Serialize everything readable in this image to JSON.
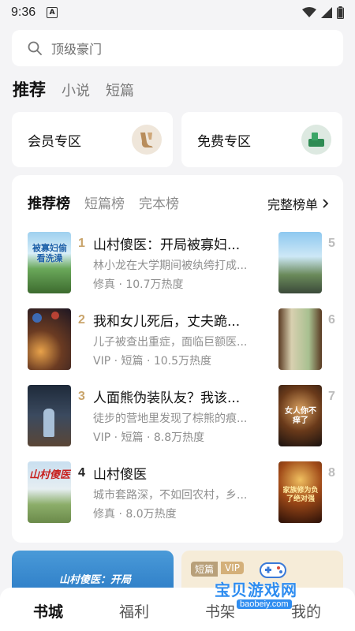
{
  "status": {
    "time": "9:36",
    "notif": "A"
  },
  "search": {
    "placeholder_text": "顶级豪门"
  },
  "top_tabs": [
    "推荐",
    "小说",
    "短篇"
  ],
  "zones": {
    "member": "会员专区",
    "free": "免费专区"
  },
  "rank": {
    "tabs": [
      "推荐榜",
      "短篇榜",
      "完本榜"
    ],
    "full_list": "完整榜单",
    "books": [
      {
        "rank": "1",
        "title": "山村傻医：开局被寡妇...",
        "desc": "林小龙在大学期间被纨绔打成...",
        "meta": "修真 · 10.7万热度",
        "cover_text": "被寡妇偷看洗澡"
      },
      {
        "rank": "2",
        "title": "我和女儿死后，丈夫跪...",
        "desc": "儿子被查出重症，面临巨额医...",
        "meta": "VIP · 短篇 · 10.5万热度"
      },
      {
        "rank": "3",
        "title": "人面熊伪装队友？我该...",
        "desc": "徒步的营地里发现了棕熊的痕...",
        "meta": "VIP · 短篇 · 8.8万热度"
      },
      {
        "rank": "4",
        "title": "山村傻医",
        "desc": "城市套路深，不如回农村，乡...",
        "meta": "修真 · 8.0万热度",
        "cover_text": "山村傻医"
      }
    ],
    "right_ranks": [
      "5",
      "6",
      "7",
      "8"
    ],
    "right_cover_texts": {
      "c7": "女人你不痒了",
      "c8": "家族修为负了绝对强"
    }
  },
  "banners": {
    "left_text": "山村傻医：开局",
    "tag_short": "短篇",
    "tag_vip": "VIP"
  },
  "bottom_nav": [
    "书城",
    "福利",
    "书架",
    "我的"
  ],
  "watermark": {
    "text": "宝贝游戏网",
    "url": "baobeiy.com"
  },
  "colors": {
    "accent_gold": "#c9a46b",
    "background": "#f4f4f6"
  }
}
